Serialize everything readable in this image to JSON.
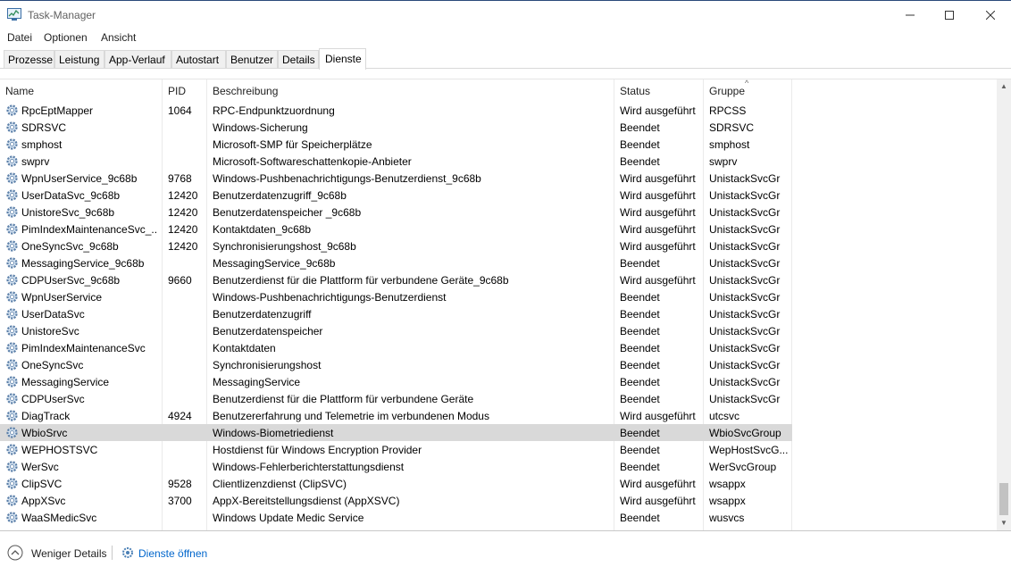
{
  "window": {
    "title": "Task-Manager"
  },
  "menu": [
    "Datei",
    "Optionen",
    "Ansicht"
  ],
  "tabs": [
    {
      "label": "Prozesse",
      "active": false
    },
    {
      "label": "Leistung",
      "active": false
    },
    {
      "label": "App-Verlauf",
      "active": false
    },
    {
      "label": "Autostart",
      "active": false
    },
    {
      "label": "Benutzer",
      "active": false
    },
    {
      "label": "Details",
      "active": false
    },
    {
      "label": "Dienste",
      "active": true
    }
  ],
  "columns": {
    "name": "Name",
    "pid": "PID",
    "desc": "Beschreibung",
    "status": "Status",
    "group": "Gruppe"
  },
  "services": [
    {
      "name": "RpcEptMapper",
      "pid": "1064",
      "desc": "RPC-Endpunktzuordnung",
      "status": "Wird ausgeführt",
      "group": "RPCSS"
    },
    {
      "name": "SDRSVC",
      "pid": "",
      "desc": "Windows-Sicherung",
      "status": "Beendet",
      "group": "SDRSVC"
    },
    {
      "name": "smphost",
      "pid": "",
      "desc": "Microsoft-SMP für Speicherplätze",
      "status": "Beendet",
      "group": "smphost"
    },
    {
      "name": "swprv",
      "pid": "",
      "desc": "Microsoft-Softwareschattenkopie-Anbieter",
      "status": "Beendet",
      "group": "swprv"
    },
    {
      "name": "WpnUserService_9c68b",
      "pid": "9768",
      "desc": "Windows-Pushbenachrichtigungs-Benutzerdienst_9c68b",
      "status": "Wird ausgeführt",
      "group": "UnistackSvcGr"
    },
    {
      "name": "UserDataSvc_9c68b",
      "pid": "12420",
      "desc": "Benutzerdatenzugriff_9c68b",
      "status": "Wird ausgeführt",
      "group": "UnistackSvcGr"
    },
    {
      "name": "UnistoreSvc_9c68b",
      "pid": "12420",
      "desc": "Benutzerdatenspeicher _9c68b",
      "status": "Wird ausgeführt",
      "group": "UnistackSvcGr"
    },
    {
      "name": "PimIndexMaintenanceSvc_...",
      "pid": "12420",
      "desc": "Kontaktdaten_9c68b",
      "status": "Wird ausgeführt",
      "group": "UnistackSvcGr"
    },
    {
      "name": "OneSyncSvc_9c68b",
      "pid": "12420",
      "desc": "Synchronisierungshost_9c68b",
      "status": "Wird ausgeführt",
      "group": "UnistackSvcGr"
    },
    {
      "name": "MessagingService_9c68b",
      "pid": "",
      "desc": "MessagingService_9c68b",
      "status": "Beendet",
      "group": "UnistackSvcGr"
    },
    {
      "name": "CDPUserSvc_9c68b",
      "pid": "9660",
      "desc": "Benutzerdienst für die Plattform für verbundene Geräte_9c68b",
      "status": "Wird ausgeführt",
      "group": "UnistackSvcGr"
    },
    {
      "name": "WpnUserService",
      "pid": "",
      "desc": "Windows-Pushbenachrichtigungs-Benutzerdienst",
      "status": "Beendet",
      "group": "UnistackSvcGr"
    },
    {
      "name": "UserDataSvc",
      "pid": "",
      "desc": "Benutzerdatenzugriff",
      "status": "Beendet",
      "group": "UnistackSvcGr"
    },
    {
      "name": "UnistoreSvc",
      "pid": "",
      "desc": "Benutzerdatenspeicher",
      "status": "Beendet",
      "group": "UnistackSvcGr"
    },
    {
      "name": "PimIndexMaintenanceSvc",
      "pid": "",
      "desc": "Kontaktdaten",
      "status": "Beendet",
      "group": "UnistackSvcGr"
    },
    {
      "name": "OneSyncSvc",
      "pid": "",
      "desc": "Synchronisierungshost",
      "status": "Beendet",
      "group": "UnistackSvcGr"
    },
    {
      "name": "MessagingService",
      "pid": "",
      "desc": "MessagingService",
      "status": "Beendet",
      "group": "UnistackSvcGr"
    },
    {
      "name": "CDPUserSvc",
      "pid": "",
      "desc": "Benutzerdienst für die Plattform für verbundene Geräte",
      "status": "Beendet",
      "group": "UnistackSvcGr"
    },
    {
      "name": "DiagTrack",
      "pid": "4924",
      "desc": "Benutzererfahrung und Telemetrie im verbundenen Modus",
      "status": "Wird ausgeführt",
      "group": "utcsvc"
    },
    {
      "name": "WbioSrvc",
      "pid": "",
      "desc": "Windows-Biometriedienst",
      "status": "Beendet",
      "group": "WbioSvcGroup",
      "selected": true
    },
    {
      "name": "WEPHOSTSVC",
      "pid": "",
      "desc": "Hostdienst für Windows Encryption Provider",
      "status": "Beendet",
      "group": "WepHostSvcG..."
    },
    {
      "name": "WerSvc",
      "pid": "",
      "desc": "Windows-Fehlerberichterstattungsdienst",
      "status": "Beendet",
      "group": "WerSvcGroup"
    },
    {
      "name": "ClipSVC",
      "pid": "9528",
      "desc": "Clientlizenzdienst (ClipSVC)",
      "status": "Wird ausgeführt",
      "group": "wsappx"
    },
    {
      "name": "AppXSvc",
      "pid": "3700",
      "desc": "AppX-Bereitstellungsdienst (AppXSVC)",
      "status": "Wird ausgeführt",
      "group": "wsappx"
    },
    {
      "name": "WaaSMedicSvc",
      "pid": "",
      "desc": "Windows Update Medic Service",
      "status": "Beendet",
      "group": "wusvcs"
    }
  ],
  "footer": {
    "fewer_details": "Weniger Details",
    "open_services": "Dienste öffnen"
  },
  "colors": {
    "accent": "#0066cc",
    "selected_row": "#d9d9d9"
  }
}
